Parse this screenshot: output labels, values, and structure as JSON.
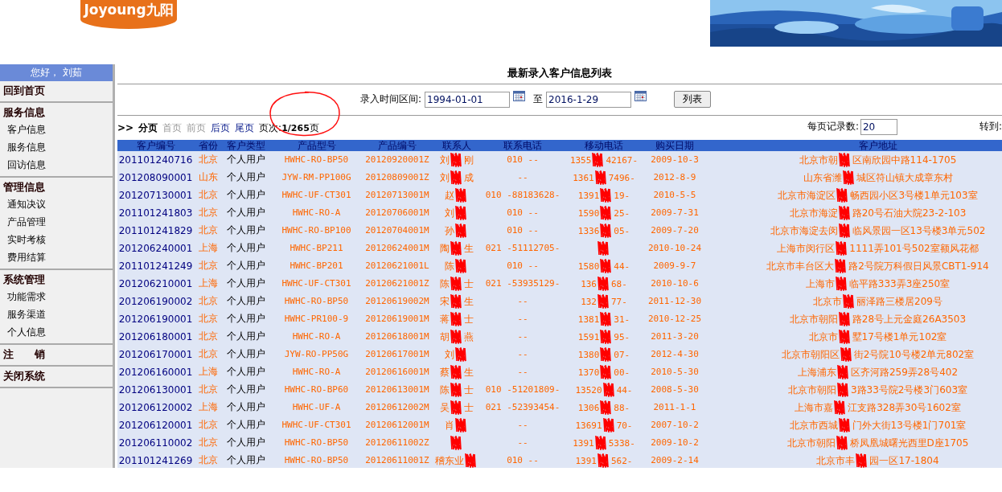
{
  "logo": {
    "text": "Joyoung九阳"
  },
  "sidebar": {
    "greeting": "您好， 刘茹",
    "sections": [
      {
        "label": "回到首页"
      },
      {
        "label": "服务信息",
        "children": [
          {
            "label": "客户信息"
          },
          {
            "label": "服务信息"
          },
          {
            "label": "回访信息"
          }
        ]
      },
      {
        "label": "管理信息",
        "children": [
          {
            "label": "通知决议"
          },
          {
            "label": "产品管理"
          },
          {
            "label": "实时考核"
          },
          {
            "label": "费用结算"
          }
        ]
      },
      {
        "label": "系统管理",
        "children": [
          {
            "label": "功能需求"
          },
          {
            "label": "服务渠道"
          },
          {
            "label": "个人信息"
          }
        ]
      },
      {
        "label": "注　　销"
      },
      {
        "label": "关闭系统"
      }
    ]
  },
  "title": "最新录入客户信息列表",
  "filter": {
    "label": "录入时间区间:",
    "from": "1994-01-01",
    "separator": "至",
    "to": "2016-1-29",
    "button": "列表"
  },
  "pager": {
    "marker": ">>",
    "label": "分页",
    "links": [
      {
        "label": "首页",
        "disabled": true
      },
      {
        "label": "前页",
        "disabled": true
      },
      {
        "label": "后页",
        "disabled": false
      },
      {
        "label": "尾页",
        "disabled": false
      }
    ],
    "page_label": "页次:",
    "page": "1/265",
    "page_suffix": "页",
    "per_page_label": "每页记录数:",
    "per_page": "20",
    "goto_label": "转到:"
  },
  "table": {
    "columns": [
      "客户编号",
      "省份",
      "客户类型",
      "产品型号",
      "产品编号",
      "联系人",
      "联系电话",
      "移动电话",
      "购买日期",
      "客户地址"
    ],
    "rows": [
      {
        "id": "201101240716",
        "province": "北京",
        "type": "个人用户",
        "model": "HWHC-RO-BP50",
        "code": "20120920001Z",
        "contact": [
          "刘",
          "刚"
        ],
        "phone": "010 --",
        "mobile": [
          "1355",
          "42167-"
        ],
        "date": "2009-10-3",
        "address": [
          "北京市朝",
          "区南欣园中路114-1705"
        ]
      },
      {
        "id": "201208090001",
        "province": "山东",
        "type": "个人用户",
        "model": "JYW-RM-PP100G",
        "code": "20120809001Z",
        "contact": [
          "刘",
          "成"
        ],
        "phone": "--",
        "mobile": [
          "1361",
          "7496-"
        ],
        "date": "2012-8-9",
        "address": [
          "山东省潍",
          "城区符山镇大成章东村"
        ]
      },
      {
        "id": "201207130001",
        "province": "北京",
        "type": "个人用户",
        "model": "HWHC-UF-CT301",
        "code": "20120713001M",
        "contact": [
          "赵"
        ],
        "phone": "010 -88183628-",
        "mobile": [
          "1391",
          "19-"
        ],
        "date": "2010-5-5",
        "address": [
          "北京市海淀区",
          "畅西园小区3号楼1单元103室"
        ]
      },
      {
        "id": "201101241803",
        "province": "北京",
        "type": "个人用户",
        "model": "HWHC-RO-A",
        "code": "20120706001M",
        "contact": [
          "刘"
        ],
        "phone": "010 --",
        "mobile": [
          "1590",
          "25-"
        ],
        "date": "2009-7-31",
        "address": [
          "北京市海淀",
          "路20号石油大院23-2-103"
        ]
      },
      {
        "id": "201101241829",
        "province": "北京",
        "type": "个人用户",
        "model": "HWHC-RO-BP100",
        "code": "20120704001M",
        "contact": [
          "孙"
        ],
        "phone": "010 --",
        "mobile": [
          "1336",
          "05-"
        ],
        "date": "2009-7-20",
        "address": [
          "北京市海淀去闵",
          "临风景园一区13号楼3单元502"
        ]
      },
      {
        "id": "201206240001",
        "province": "上海",
        "type": "个人用户",
        "model": "HWHC-BP211",
        "code": "20120624001M",
        "contact": [
          "陶",
          "生"
        ],
        "phone": "021 -51112705-",
        "date": "2010-10-24",
        "address": [
          "上海市闵行区",
          "1111弄101号502室额风花都"
        ]
      },
      {
        "id": "201101241249",
        "province": "北京",
        "type": "个人用户",
        "model": "HWHC-BP201",
        "code": "20120621001L",
        "contact": [
          "陈"
        ],
        "phone": "010 --",
        "mobile": [
          "1580",
          "44-"
        ],
        "date": "2009-9-7",
        "address": [
          "北京市丰台区大",
          "路2号院万科假日风景CBT1-914"
        ]
      },
      {
        "id": "201206210001",
        "province": "上海",
        "type": "个人用户",
        "model": "HWHC-UF-CT301",
        "code": "20120621001Z",
        "contact": [
          "陈",
          "士"
        ],
        "phone": "021 -53935129-",
        "mobile": [
          "136",
          "68-"
        ],
        "date": "2010-10-6",
        "address": [
          "上海市",
          "临平路333弄3座250室"
        ]
      },
      {
        "id": "201206190002",
        "province": "北京",
        "type": "个人用户",
        "model": "HWHC-RO-BP50",
        "code": "20120619002M",
        "contact": [
          "宋",
          "生"
        ],
        "phone": "--",
        "mobile": [
          "132",
          "77-"
        ],
        "date": "2011-12-30",
        "address": [
          "北京市",
          "丽泽路三楼居209号"
        ]
      },
      {
        "id": "201206190001",
        "province": "北京",
        "type": "个人用户",
        "model": "HWHC-PR100-9",
        "code": "20120619001M",
        "contact": [
          "蒋",
          "士"
        ],
        "phone": "--",
        "mobile": [
          "1381",
          "31-"
        ],
        "date": "2010-12-25",
        "address": [
          "北京市朝阳",
          "路28号上元金庭26A3503"
        ]
      },
      {
        "id": "201206180001",
        "province": "北京",
        "type": "个人用户",
        "model": "HWHC-RO-A",
        "code": "20120618001M",
        "contact": [
          "胡",
          "燕"
        ],
        "phone": "--",
        "mobile": [
          "1591",
          "95-"
        ],
        "date": "2011-3-20",
        "address": [
          "北京市",
          "墅17号楼1单元102室"
        ]
      },
      {
        "id": "201206170001",
        "province": "北京",
        "type": "个人用户",
        "model": "JYW-RO-PP50G",
        "code": "20120617001M",
        "contact": [
          "刘"
        ],
        "phone": "--",
        "mobile": [
          "1380",
          "07-"
        ],
        "date": "2012-4-30",
        "address": [
          "北京市朝阳区",
          "街2号院10号楼2单元802室"
        ]
      },
      {
        "id": "201206160001",
        "province": "上海",
        "type": "个人用户",
        "model": "HWHC-RO-A",
        "code": "20120616001M",
        "contact": [
          "蔡",
          "生"
        ],
        "phone": "--",
        "mobile": [
          "1370",
          "00-"
        ],
        "date": "2010-5-30",
        "address": [
          "上海浦东",
          "区齐河路259弄28号402"
        ]
      },
      {
        "id": "201206130001",
        "province": "北京",
        "type": "个人用户",
        "model": "HWHC-RO-BP60",
        "code": "20120613001M",
        "contact": [
          "陈",
          "士"
        ],
        "phone": "010 -51201809-",
        "mobile": [
          "13520",
          "44-"
        ],
        "date": "2008-5-30",
        "address": [
          "北京市朝阳",
          "3路33号院2号楼3门603室"
        ]
      },
      {
        "id": "201206120002",
        "province": "上海",
        "type": "个人用户",
        "model": "HWHC-UF-A",
        "code": "20120612002M",
        "contact": [
          "吴",
          "士"
        ],
        "phone": "021 -52393454-",
        "mobile": [
          "1306",
          "88-"
        ],
        "date": "2011-1-1",
        "address": [
          "上海市嘉",
          "江支路328弄30号1602室"
        ]
      },
      {
        "id": "201206120001",
        "province": "北京",
        "type": "个人用户",
        "model": "HWHC-UF-CT301",
        "code": "20120612001M",
        "contact": [
          "肖"
        ],
        "phone": "--",
        "mobile": [
          "13691",
          "70-"
        ],
        "date": "2007-10-2",
        "address": [
          "北京市西城",
          "门外大街13号楼1门701室"
        ]
      },
      {
        "id": "201206110002",
        "province": "北京",
        "type": "个人用户",
        "model": "HWHC-RO-BP50",
        "code": "20120611002Z",
        "phone": "--",
        "mobile": [
          "1391",
          "5338-"
        ],
        "date": "2009-10-2",
        "address": [
          "北京市朝阳",
          "桥凤凰城曙光西里D座1705"
        ]
      },
      {
        "id": "201101241269",
        "province": "北京",
        "type": "个人用户",
        "model": "HWHC-RO-BP50",
        "code": "20120611001Z",
        "contact": [
          "稽东业"
        ],
        "phone": "010 --",
        "mobile": [
          "1391",
          "562-"
        ],
        "date": "2009-2-14",
        "address": [
          "北京市丰",
          "园一区17-1804"
        ]
      }
    ]
  }
}
